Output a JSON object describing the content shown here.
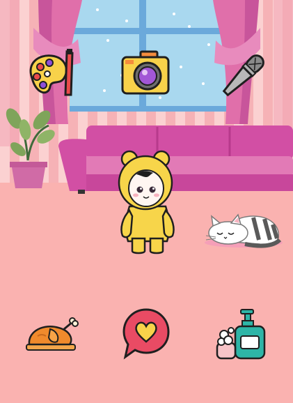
{
  "game": {
    "screen": "living-room",
    "character": "baby-in-yellow-bear-costume",
    "pet": "sleeping-cat"
  },
  "top_actions": [
    {
      "id": "paint",
      "icon": "paint-palette-icon"
    },
    {
      "id": "photo",
      "icon": "camera-icon"
    },
    {
      "id": "sing",
      "icon": "microphone-icon"
    }
  ],
  "bottom_actions": [
    {
      "id": "feed",
      "icon": "roast-chicken-icon"
    },
    {
      "id": "love",
      "icon": "heart-speech-bubble-icon"
    },
    {
      "id": "wash",
      "icon": "soap-dispenser-icon"
    }
  ],
  "colors": {
    "wall": "#F7B5B7",
    "stripe": "#FBD1D1",
    "floor": "#FAB2B0",
    "window_sky": "#A9D8EF",
    "curtain": "#E06FAA",
    "sofa": "#D24FA4",
    "costume": "#F7D54A"
  }
}
